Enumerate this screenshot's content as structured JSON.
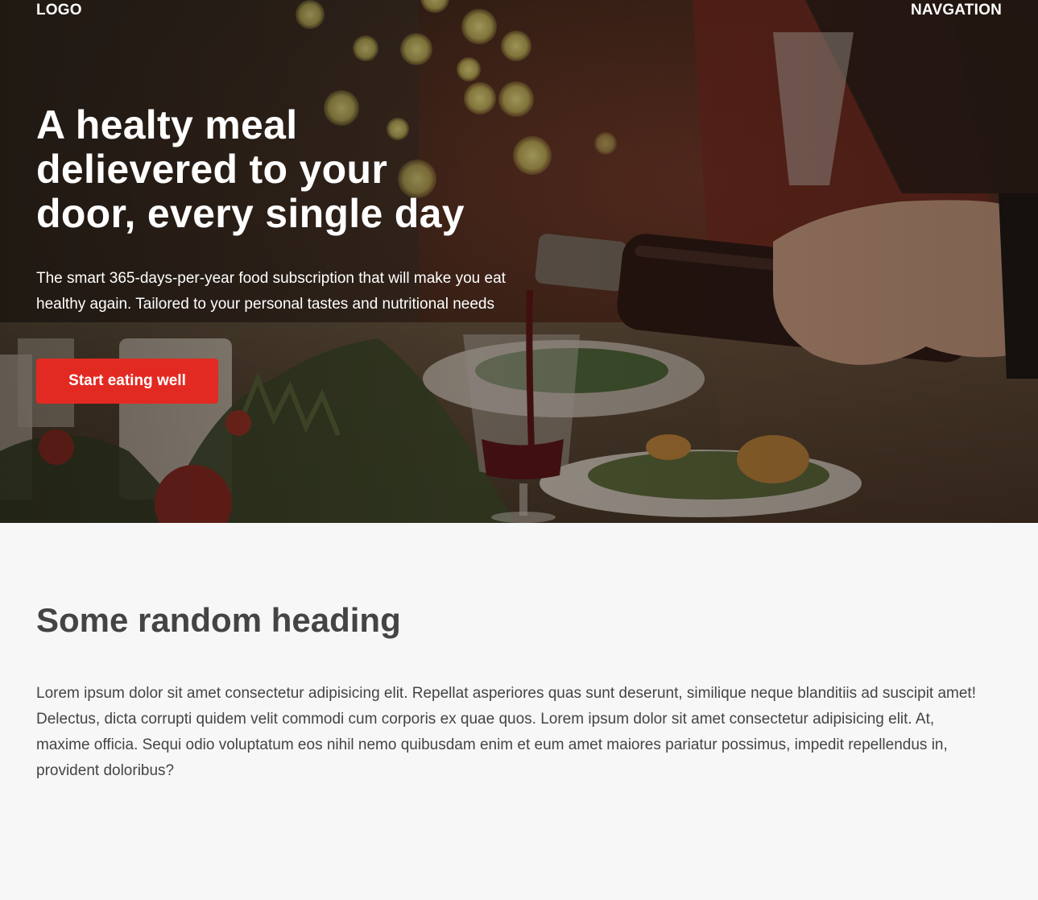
{
  "header": {
    "logo": "LOGO",
    "navigation": "NAVGATION"
  },
  "hero": {
    "title_lines": [
      "A healty meal",
      "delievered to your",
      "door, every single day"
    ],
    "subtitle": "The smart 365-days-per-year food subscription that will make you eat healthy again. Tailored to your personal tastes and nutritional needs",
    "cta_label": "Start eating well",
    "cta_color": "#e32a22"
  },
  "section": {
    "heading": "Some random heading",
    "body": "Lorem ipsum dolor sit amet consectetur adipisicing elit. Repellat asperiores quas sunt deserunt, similique neque blanditiis ad suscipit amet! Delectus, dicta corrupti quidem velit commodi cum corporis ex quae quos. Lorem ipsum dolor sit amet consectetur adipisicing elit. At, maxime officia. Sequi odio voluptatum eos nihil nemo quibusdam enim et eum amet maiores pariatur possimus, impedit repellendus in, provident doloribus?"
  },
  "colors": {
    "page_background": "#f7f7f7",
    "text_dark": "#444444",
    "hero_text": "#ffffff"
  }
}
